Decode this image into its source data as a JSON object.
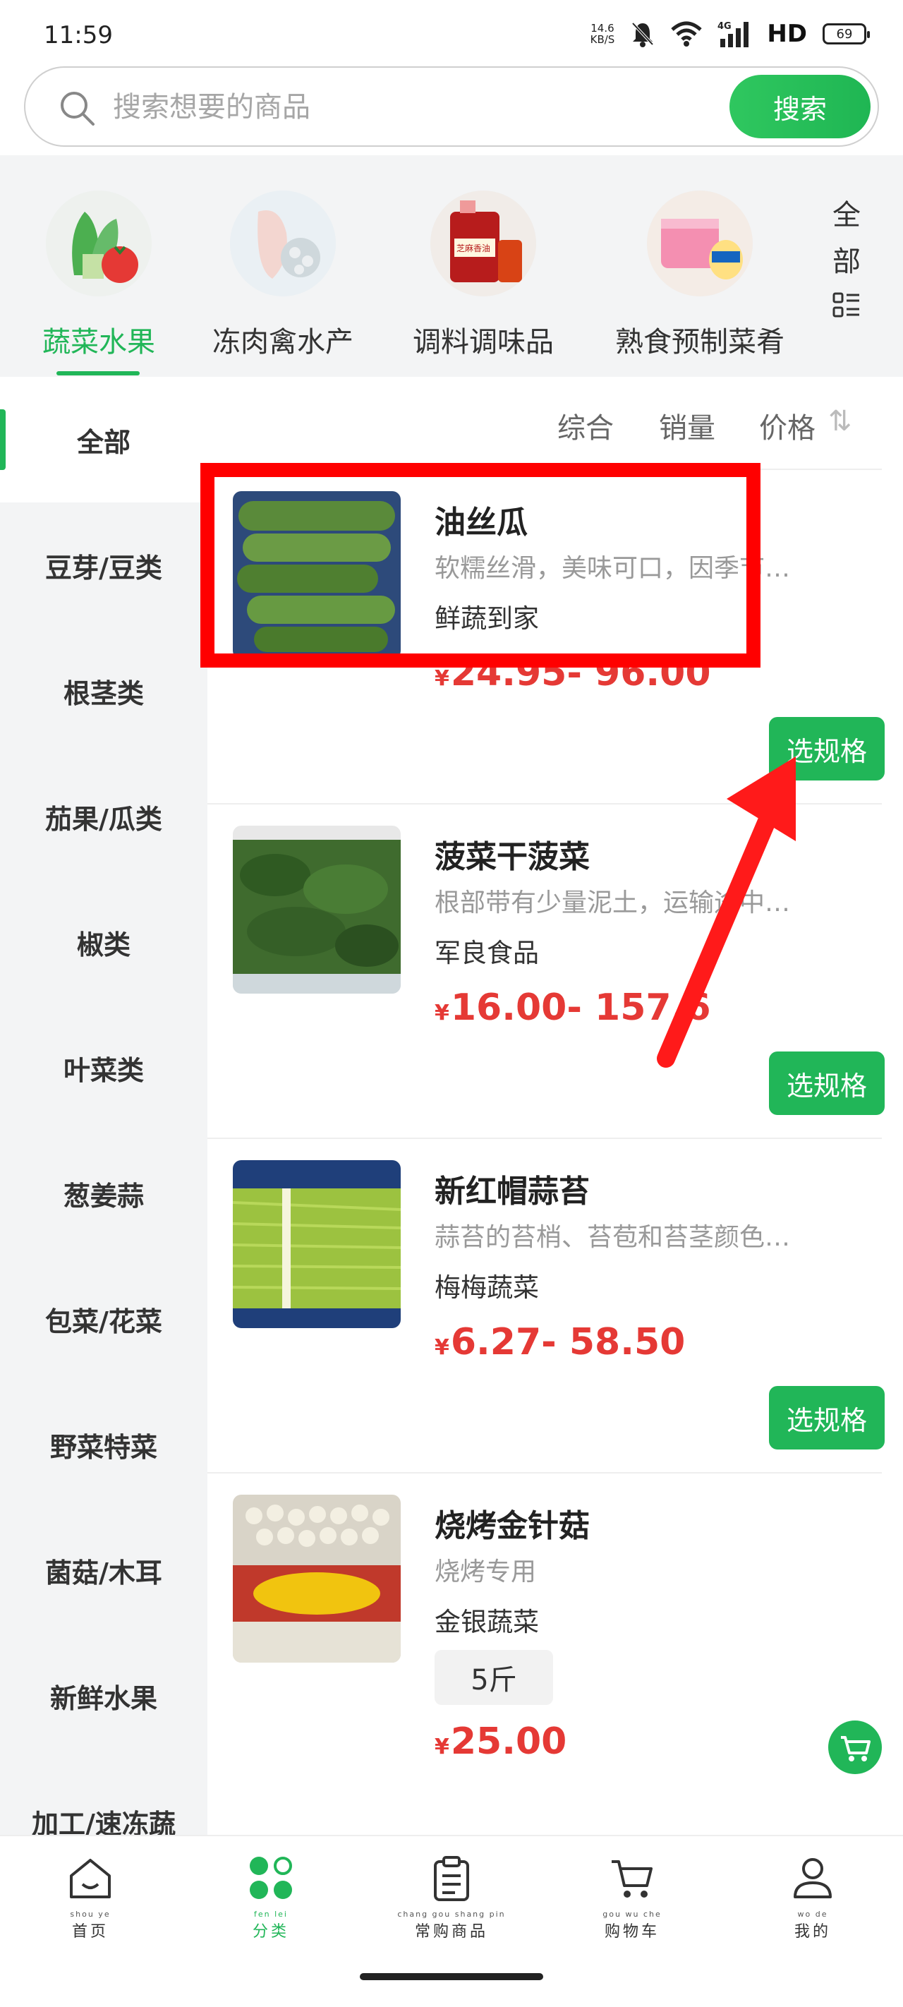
{
  "status_bar": {
    "time": "11:59",
    "net_speed_value": "14.6",
    "net_speed_unit": "KB/S",
    "hd": "HD",
    "network": "4G",
    "battery": "69"
  },
  "search": {
    "placeholder": "搜索想要的商品",
    "button": "搜索"
  },
  "categories": [
    {
      "label": "蔬菜水果",
      "active": true
    },
    {
      "label": "冻肉禽水产",
      "active": false
    },
    {
      "label": "调料调味品",
      "active": false
    },
    {
      "label": "熟食预制菜肴",
      "active": false
    }
  ],
  "category_all": {
    "line1": "全",
    "line2": "部"
  },
  "category_image_text": {
    "seasoning": "芝麻香油"
  },
  "sidebar": [
    "全部",
    "豆芽/豆类",
    "根茎类",
    "茄果/瓜类",
    "椒类",
    "叶菜类",
    "葱姜蒜",
    "包菜/花菜",
    "野菜特菜",
    "菌菇/木耳",
    "新鲜水果",
    "加工/速冻蔬"
  ],
  "sort": {
    "comprehensive": "综合",
    "sales": "销量",
    "price": "价格",
    "price_arrows": "⇅"
  },
  "products": [
    {
      "name": "油丝瓜",
      "desc": "软糯丝滑，美味可口，因季节…",
      "shop": "鲜蔬到家",
      "yen": "¥",
      "price": "24.95- 96.00",
      "action": "选规格"
    },
    {
      "name": "菠菜干菠菜",
      "desc": "根部带有少量泥土，运输途中…",
      "shop": "军良食品",
      "yen": "¥",
      "price": "16.00- 157.6",
      "action": "选规格"
    },
    {
      "name": "新红帽蒜苔",
      "desc": "蒜苔的苔梢、苔苞和苔茎颜色…",
      "shop": "梅梅蔬菜",
      "yen": "¥",
      "price": "6.27- 58.50",
      "action": "选规格"
    },
    {
      "name": "烧烤金针菇",
      "desc": "烧烤专用",
      "shop": "金银蔬菜",
      "size": "5斤",
      "yen": "¥",
      "price": "25.00"
    }
  ],
  "bottom_nav": [
    {
      "pinyin": "shou  ye",
      "label": "首页",
      "icon": "home-icon",
      "active": false
    },
    {
      "pinyin": "fen  lei",
      "label": "分类",
      "icon": "category-icon",
      "active": true
    },
    {
      "pinyin": "chang gou shang pin",
      "label": "常购商品",
      "icon": "clipboard-icon",
      "active": false
    },
    {
      "pinyin": "gou  wu  che",
      "label": "购物车",
      "icon": "cart-icon",
      "active": false
    },
    {
      "pinyin": "wo  de",
      "label": "我的",
      "icon": "user-icon",
      "active": false
    }
  ],
  "colors": {
    "accent": "#21b658",
    "price": "#e53935",
    "annotation": "#ff0000"
  }
}
